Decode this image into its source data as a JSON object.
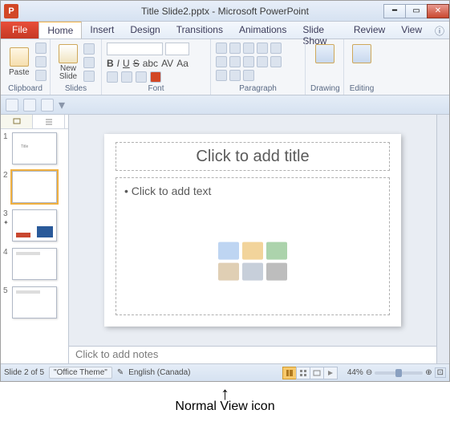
{
  "titlebar": {
    "title": "Title Slide2.pptx - Microsoft PowerPoint",
    "app_letter": "P"
  },
  "menu": {
    "file": "File",
    "tabs": [
      "Home",
      "Insert",
      "Design",
      "Transitions",
      "Animations",
      "Slide Show",
      "Review",
      "View"
    ],
    "active": 0
  },
  "ribbon": {
    "clipboard": {
      "label": "Clipboard",
      "paste": "Paste"
    },
    "slides": {
      "label": "Slides",
      "new_slide": "New\nSlide"
    },
    "font": {
      "label": "Font"
    },
    "paragraph": {
      "label": "Paragraph"
    },
    "drawing": {
      "label": "Drawing"
    },
    "editing": {
      "label": "Editing"
    }
  },
  "thumbnails": {
    "count": 5,
    "selected": 2
  },
  "slide": {
    "title_placeholder": "Click to add title",
    "body_placeholder": "Click to add text"
  },
  "notes": {
    "placeholder": "Click to add notes"
  },
  "status": {
    "slide_info": "Slide 2 of 5",
    "theme": "\"Office Theme\"",
    "language": "English (Canada)",
    "zoom": "44%"
  },
  "annotation": {
    "label": "Normal View icon"
  }
}
